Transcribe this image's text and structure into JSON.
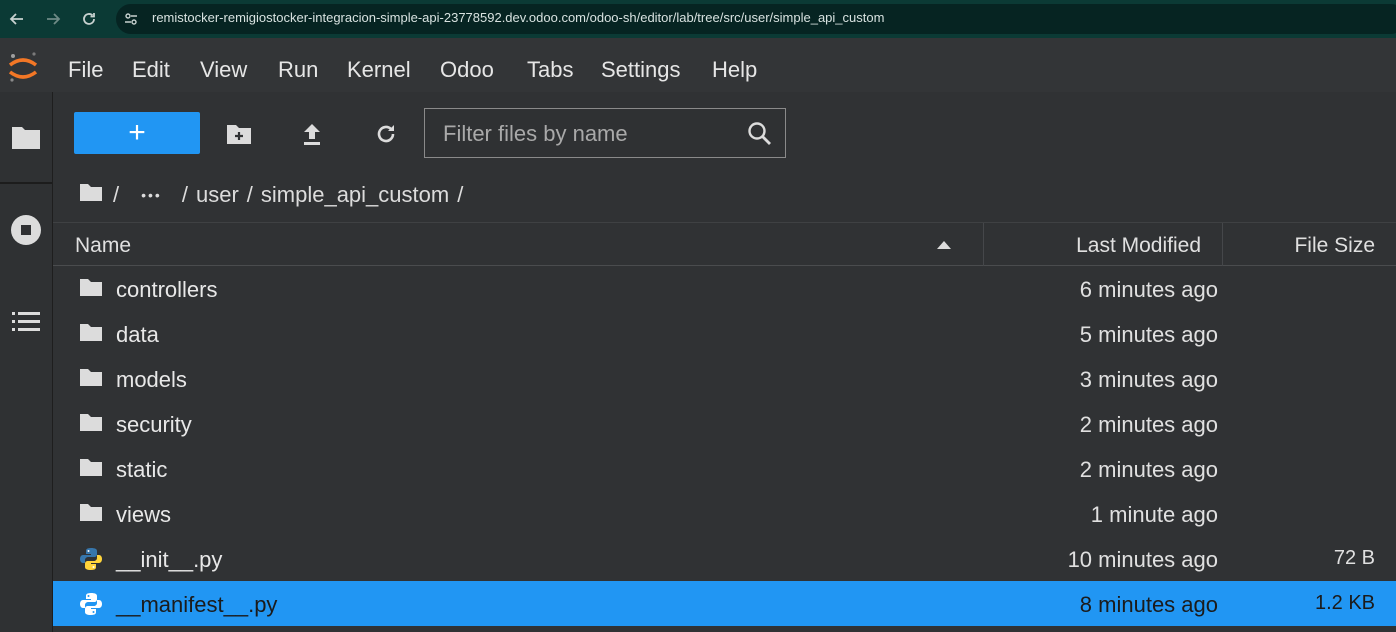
{
  "browser": {
    "url": "remistocker-remigiostocker-integracion-simple-api-23778592.dev.odoo.com/odoo-sh/editor/lab/tree/src/user/simple_api_custom",
    "back_icon": "arrow-left-icon",
    "forward_icon": "arrow-right-icon",
    "reload_icon": "reload-icon",
    "site_info_icon": "tune-icon"
  },
  "menu": {
    "items": [
      "File",
      "Edit",
      "View",
      "Run",
      "Kernel",
      "Odoo",
      "Tabs",
      "Settings",
      "Help"
    ]
  },
  "toolbar": {
    "new_label": "+",
    "filter_placeholder": "Filter files by name"
  },
  "breadcrumb": {
    "sep": "/",
    "ellipsis": "•••",
    "parts": [
      "user",
      "simple_api_custom"
    ]
  },
  "columns": {
    "name": "Name",
    "last_modified": "Last Modified",
    "file_size": "File Size"
  },
  "files": [
    {
      "name": "controllers",
      "type": "folder",
      "modified": "6 minutes ago",
      "size": ""
    },
    {
      "name": "data",
      "type": "folder",
      "modified": "5 minutes ago",
      "size": ""
    },
    {
      "name": "models",
      "type": "folder",
      "modified": "3 minutes ago",
      "size": ""
    },
    {
      "name": "security",
      "type": "folder",
      "modified": "2 minutes ago",
      "size": ""
    },
    {
      "name": "static",
      "type": "folder",
      "modified": "2 minutes ago",
      "size": ""
    },
    {
      "name": "views",
      "type": "folder",
      "modified": "1 minute ago",
      "size": ""
    },
    {
      "name": "__init__.py",
      "type": "python",
      "modified": "10 minutes ago",
      "size": "72 B"
    },
    {
      "name": "__manifest__.py",
      "type": "python",
      "modified": "8 minutes ago",
      "size": "1.2 KB",
      "selected": true
    }
  ],
  "colors": {
    "accent": "#2196f3",
    "panel": "#303234",
    "browser_bar": "#0b3a35",
    "jupyter_orange": "#f37726"
  }
}
